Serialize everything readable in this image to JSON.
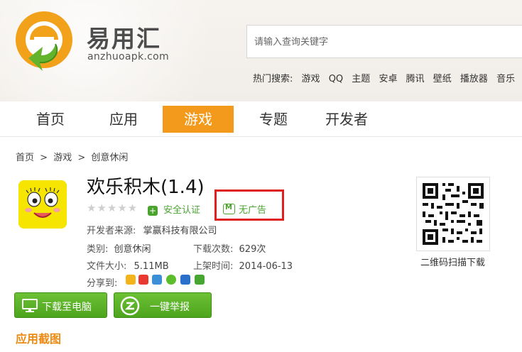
{
  "header": {
    "brand_name": "易用汇",
    "brand_url": "anzhuoapk.com",
    "search_placeholder": "请输入查询关键字",
    "hot_label": "热门搜索:",
    "hot_keywords": [
      "游戏",
      "QQ",
      "主题",
      "安卓",
      "腾讯",
      "壁纸",
      "播放器",
      "音乐"
    ]
  },
  "nav": {
    "items": [
      {
        "label": "首页"
      },
      {
        "label": "应用"
      },
      {
        "label": "游戏"
      },
      {
        "label": "专题"
      },
      {
        "label": "开发者"
      }
    ],
    "active": "游戏"
  },
  "breadcrumb": {
    "items": [
      "首页",
      ">",
      "游戏",
      ">",
      "创意休闲"
    ]
  },
  "app": {
    "title": "欢乐积木(1.4)",
    "stars": "★★★★★",
    "safe_label": "安全认证",
    "noad_label": "无广告",
    "developer_key": "开发者来源:",
    "developer_val": "掌赢科技有限公司",
    "category_key": "类别:",
    "category_val": "创意休闲",
    "downloads_key": "下载次数:",
    "downloads_val": "629次",
    "size_key": "文件大小:",
    "size_val": "5.11MB",
    "date_key": "上架时间:",
    "date_val": "2014-06-13",
    "share_key": "分享到:",
    "download_button": "下载至电脑",
    "report_button": "一键举报",
    "qr_caption": "二维码扫描下载"
  },
  "section": {
    "screenshots_title": "应用截图"
  },
  "colors": {
    "accent_orange": "#f39a1d",
    "green": "#4da51e",
    "highlight_red": "#e0201c"
  }
}
